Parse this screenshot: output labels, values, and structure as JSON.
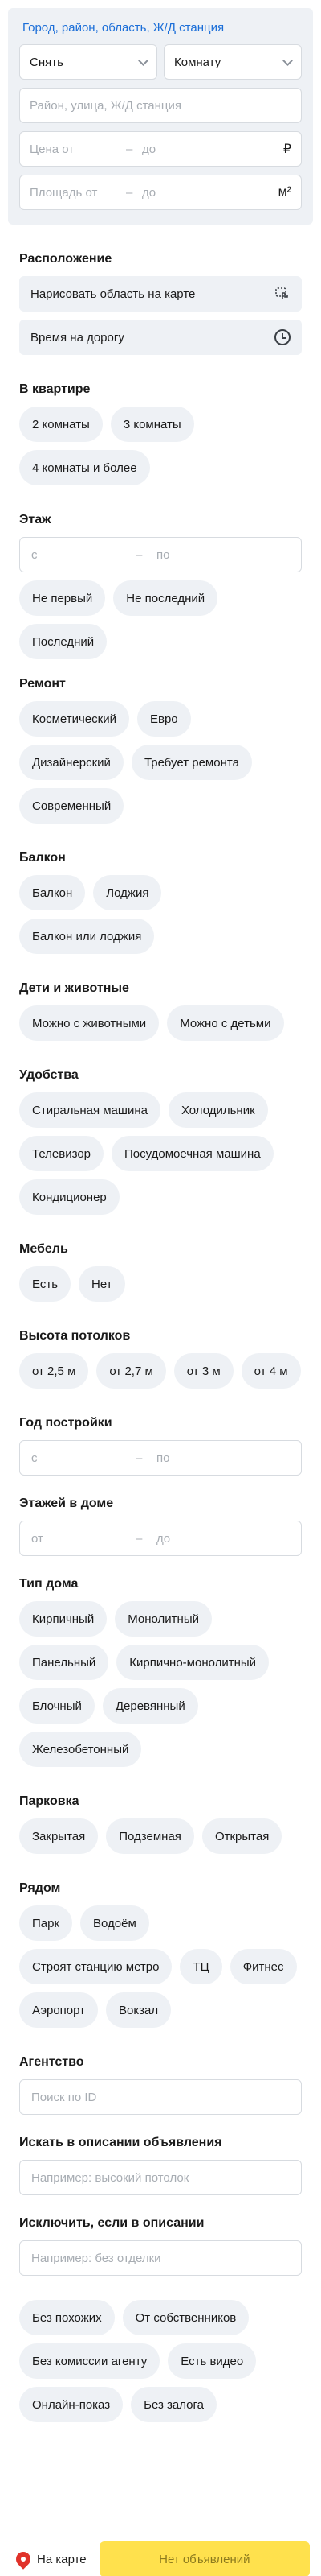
{
  "top": {
    "geo_link": "Город, район, область, Ж/Д станция",
    "deal_type": "Снять",
    "property_type": "Комнату",
    "address_placeholder": "Район, улица, Ж/Д станция",
    "price": {
      "from": "Цена от",
      "to": "до",
      "unit": "₽"
    },
    "area": {
      "from": "Площадь от",
      "to": "до",
      "unit": "м²"
    }
  },
  "location": {
    "title": "Расположение",
    "draw_area": "Нарисовать область на карте",
    "travel_time": "Время на дорогу"
  },
  "rooms": {
    "title": "В квартире",
    "chips": [
      "2 комнаты",
      "3 комнаты",
      "4 комнаты и более"
    ]
  },
  "floor": {
    "title": "Этаж",
    "from": "с",
    "to": "по",
    "chips": [
      "Не первый",
      "Не последний",
      "Последний"
    ]
  },
  "renovation": {
    "title": "Ремонт",
    "chips": [
      "Косметический",
      "Евро",
      "Дизайнерский",
      "Требует ремонта",
      "Современный"
    ]
  },
  "balcony": {
    "title": "Балкон",
    "chips": [
      "Балкон",
      "Лоджия",
      "Балкон или лоджия"
    ]
  },
  "kids_pets": {
    "title": "Дети и животные",
    "chips": [
      "Можно с животными",
      "Можно с детьми"
    ]
  },
  "amenities": {
    "title": "Удобства",
    "chips": [
      "Стиральная машина",
      "Холодильник",
      "Телевизор",
      "Посудомоечная машина",
      "Кондиционер"
    ]
  },
  "furniture": {
    "title": "Мебель",
    "chips": [
      "Есть",
      "Нет"
    ]
  },
  "ceiling": {
    "title": "Высота потолков",
    "chips": [
      "от 2,5 м",
      "от 2,7 м",
      "от 3 м",
      "от 4 м"
    ]
  },
  "built_year": {
    "title": "Год постройки",
    "from": "с",
    "to": "по"
  },
  "floors_total": {
    "title": "Этажей в доме",
    "from": "от",
    "to": "до"
  },
  "house_type": {
    "title": "Тип дома",
    "chips": [
      "Кирпичный",
      "Монолитный",
      "Панельный",
      "Кирпично-монолитный",
      "Блочный",
      "Деревянный",
      "Железобетонный"
    ]
  },
  "parking": {
    "title": "Парковка",
    "chips": [
      "Закрытая",
      "Подземная",
      "Открытая"
    ]
  },
  "nearby": {
    "title": "Рядом",
    "chips": [
      "Парк",
      "Водоём",
      "Строят станцию метро",
      "ТЦ",
      "Фитнес",
      "Аэропорт",
      "Вокзал"
    ]
  },
  "agency": {
    "title": "Агентство",
    "placeholder": "Поиск по ID"
  },
  "search_desc": {
    "title": "Искать в описании объявления",
    "placeholder": "Например: высокий потолок"
  },
  "exclude_desc": {
    "title": "Исключить, если в описании",
    "placeholder": "Например: без отделки"
  },
  "extra": {
    "chips": [
      "Без похожих",
      "От собственников",
      "Без комиссии агенту",
      "Есть видео",
      "Онлайн-показ",
      "Без залога"
    ]
  },
  "bottom": {
    "map_label": "На карте",
    "submit_label": "Нет объявлений"
  }
}
